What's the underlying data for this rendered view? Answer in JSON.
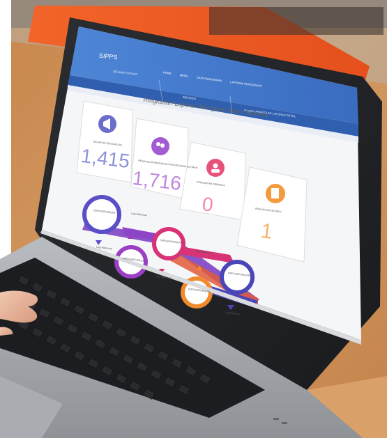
{
  "app": {
    "logo_text": "SIPPS"
  },
  "header": {
    "nav_items": [
      "HOME",
      "MENU",
      "DATA PENGADUAN",
      "LAPORAN PENGADUAN"
    ],
    "left_block_title": "SELAMAT DATANG",
    "middle_block_title": "BERANDA",
    "right_block_title": "Program PANGGILAN LAPORAN DETAIL"
  },
  "dashboard": {
    "heading": "Ringkasan Laporan Mengikuti Bulan Semasa",
    "cards": [
      {
        "title": "BILANGAN PENGADUAN",
        "value": "1,415",
        "color": "#6b6fc9",
        "icon": "megaphone-icon"
      },
      {
        "title": "PENGADUAN MENUNGGU PENGESAHAN BUTIRAN",
        "value": "1,716",
        "color": "#a35bd1",
        "icon": "people-icon"
      },
      {
        "title": "PENGADUAN DIBERKAS",
        "value": "0",
        "color": "#e8527a",
        "icon": "user-icon"
      },
      {
        "title": "PENGADUAN SELESAI",
        "value": "1",
        "color": "#f39a3c",
        "icon": "document-icon"
      }
    ]
  },
  "timeline": {
    "circles": [
      {
        "label": "DATA-DATA BULAN",
        "color": "#5a4fc7"
      },
      {
        "label": "DATA-DATA BULAN",
        "color": "#9b3fc4"
      },
      {
        "label": "DATA-DATA BULAN",
        "color": "#d83376"
      },
      {
        "label": "DATA-DATA BULAN",
        "color": "#f08a2e"
      },
      {
        "label": "DATA-DATA BULAN",
        "color": "#4a46b8"
      }
    ],
    "small_label": "Lagi Maklumat"
  }
}
